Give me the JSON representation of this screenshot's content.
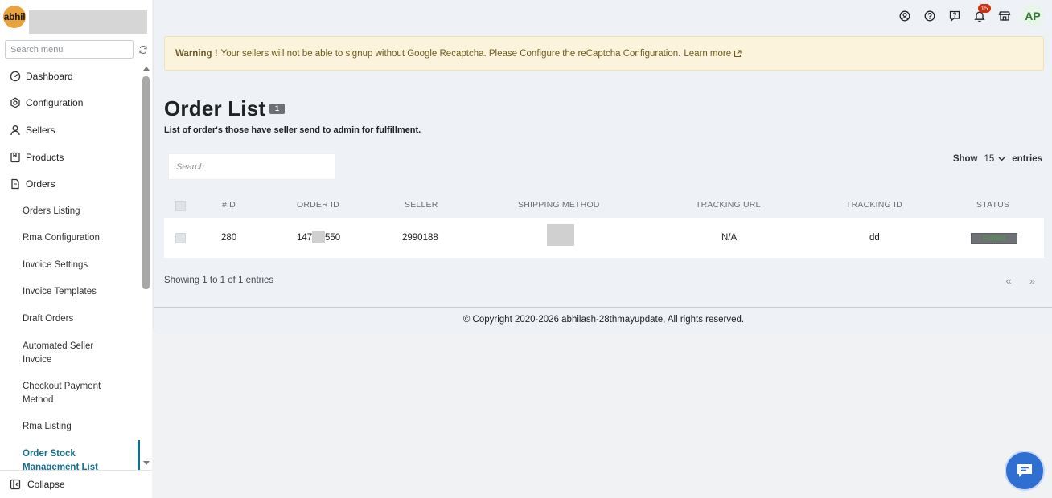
{
  "sidebar": {
    "logo_text": "abhil",
    "search_placeholder": "Search menu",
    "items": [
      {
        "label": "Dashboard",
        "icon": "dashboard-icon"
      },
      {
        "label": "Configuration",
        "icon": "gear-icon"
      },
      {
        "label": "Sellers",
        "icon": "user-icon"
      },
      {
        "label": "Products",
        "icon": "product-icon"
      },
      {
        "label": "Orders",
        "icon": "document-icon"
      }
    ],
    "sub_items": [
      "Orders Listing",
      "Rma Configuration",
      "Invoice Settings",
      "Invoice Templates",
      "Draft Orders",
      "Automated Seller Invoice",
      "Checkout Payment Method",
      "Rma Listing",
      "Order Stock Management List"
    ],
    "collapse_label": "Collapse"
  },
  "topbar": {
    "notification_count": "15",
    "avatar_initials": "AP",
    "icons": [
      "account-icon",
      "help-icon",
      "feedback-icon",
      "bell-icon",
      "store-icon"
    ]
  },
  "warning": {
    "strong": "Warning !",
    "text": "Your sellers will not be able to signup without Google Recaptcha. Please Configure the reCaptcha Configuration.",
    "link": "Learn more"
  },
  "page": {
    "title": "Order List",
    "count": "1",
    "subtitle": "List of order's those have seller send to admin for fulfillment."
  },
  "table": {
    "search_placeholder": "Search",
    "show_label": "Show",
    "entries_value": "15",
    "entries_label": "entries",
    "columns": [
      "#ID",
      "ORDER ID",
      "SELLER",
      "SHIPPING METHOD",
      "TRACKING URL",
      "TRACKING ID",
      "STATUS"
    ],
    "rows": [
      {
        "id": "280",
        "order_id_prefix": "147",
        "order_id_suffix": "550",
        "seller": "2990188",
        "shipping_method": "",
        "tracking_url": "N/A",
        "tracking_id": "dd",
        "status": "Fulfilled"
      }
    ],
    "showing_text": "Showing 1 to 1 of 1 entries",
    "prev": "«",
    "next": "»"
  },
  "footer": {
    "copyright": "© Copyright 2020-2026 abhilash-28thmayupdate, All rights reserved."
  },
  "colors": {
    "accent": "#136f8b",
    "warning_bg": "#fcf3dc",
    "badge": "#d72c0d",
    "chat": "#2f6fd1"
  }
}
